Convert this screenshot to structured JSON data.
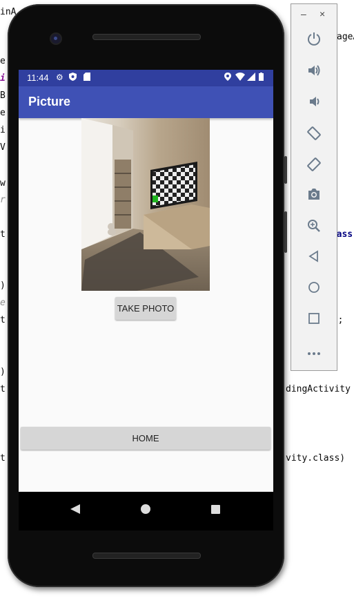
{
  "ide": {
    "top_left_fragment": "inA",
    "top_right_fragment": "ageA",
    "left_col": [
      "e",
      "i",
      "B",
      "e",
      "i",
      "V",
      "w",
      "r",
      "t",
      ")",
      "e",
      "t",
      ")",
      "t",
      "t"
    ],
    "right_lines": [
      "class",
      "s);",
      "dingActivity",
      "vity.class)"
    ]
  },
  "status_bar": {
    "time": "11:44"
  },
  "app_bar": {
    "title": "Picture"
  },
  "buttons": {
    "take_photo": "TAKE PHOTO",
    "home": "HOME"
  },
  "emulator_panel": {
    "minimize": "–",
    "close": "×",
    "tools": [
      "power",
      "volume-up",
      "volume-down",
      "rotate-left",
      "rotate-right",
      "screenshot",
      "zoom",
      "back",
      "home",
      "overview",
      "more"
    ]
  },
  "colors": {
    "primary": "#3f51b5",
    "primary_dark": "#303f9f",
    "button_bg": "#d6d6d6",
    "screen_bg": "#fafafa"
  }
}
